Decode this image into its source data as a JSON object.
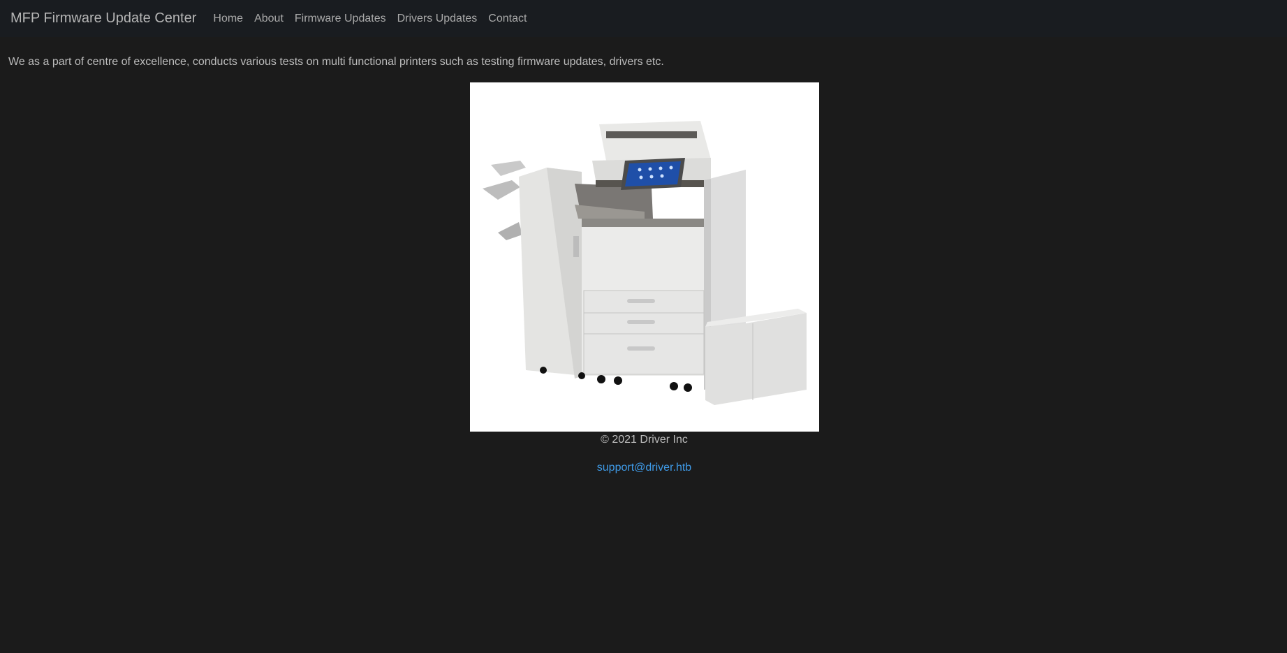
{
  "navbar": {
    "brand": "MFP Firmware Update Center",
    "links": [
      {
        "label": "Home"
      },
      {
        "label": "About"
      },
      {
        "label": "Firmware Updates"
      },
      {
        "label": "Drivers Updates"
      },
      {
        "label": "Contact"
      }
    ]
  },
  "main": {
    "intro": "We as a part of centre of excellence, conducts various tests on multi functional printers such as testing firmware updates, drivers etc."
  },
  "footer": {
    "copyright": "© 2021 Driver Inc",
    "email": "support@driver.htb"
  },
  "colors": {
    "background": "#1b1b1b",
    "navbar": "#191c20",
    "link_accent": "#3f9be8"
  }
}
